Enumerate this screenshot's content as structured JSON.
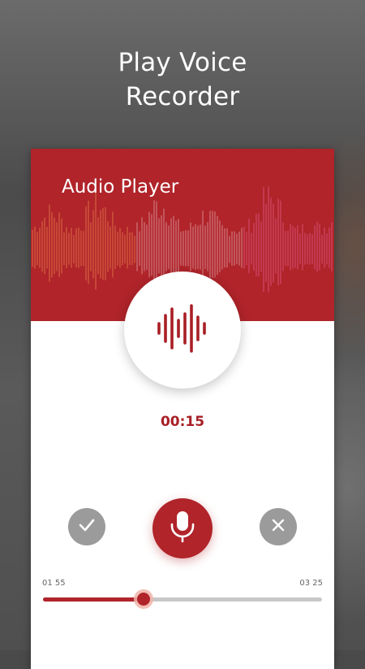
{
  "promo": {
    "line1": "Play Voice",
    "line2": "Recorder"
  },
  "player": {
    "title": "Audio Player",
    "timer": "00:15",
    "time_current": "01 55",
    "time_total": "03 25",
    "progress": 0.36
  },
  "icons": {
    "center": "waveform-icon",
    "accept": "check-icon",
    "record": "microphone-icon",
    "cancel": "close-icon"
  },
  "colors": {
    "accent": "#b0242a",
    "button_gray": "#9b9b9b"
  }
}
